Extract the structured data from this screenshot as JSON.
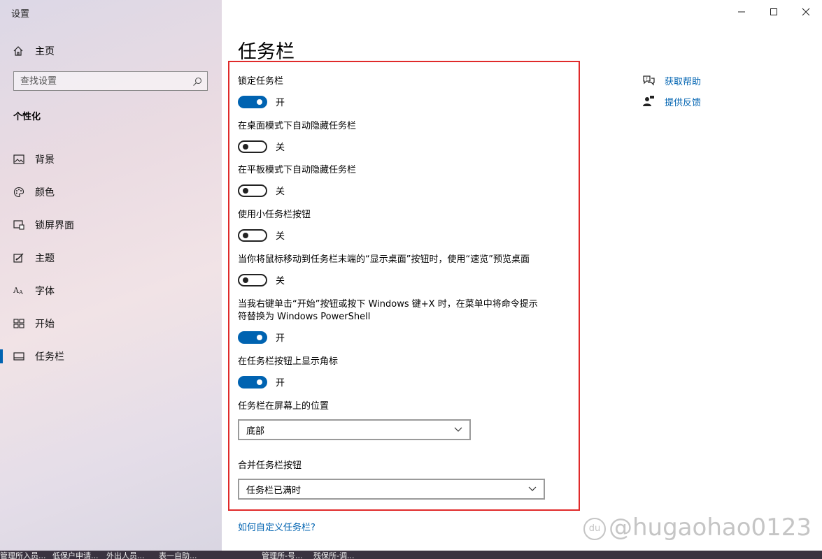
{
  "window": {
    "title": "设置"
  },
  "sidebar": {
    "home_label": "主页",
    "search_placeholder": "查找设置",
    "section": "个性化",
    "items": [
      {
        "label": "背景",
        "icon": "image-icon"
      },
      {
        "label": "颜色",
        "icon": "palette-icon"
      },
      {
        "label": "锁屏界面",
        "icon": "lock-screen-icon"
      },
      {
        "label": "主题",
        "icon": "theme-icon"
      },
      {
        "label": "字体",
        "icon": "font-icon"
      },
      {
        "label": "开始",
        "icon": "start-grid-icon"
      },
      {
        "label": "任务栏",
        "icon": "taskbar-icon",
        "active": true
      }
    ]
  },
  "main": {
    "title": "任务栏",
    "settings": [
      {
        "label": "锁定任务栏",
        "state": "开",
        "on": true
      },
      {
        "label": "在桌面模式下自动隐藏任务栏",
        "state": "关",
        "on": false
      },
      {
        "label": "在平板模式下自动隐藏任务栏",
        "state": "关",
        "on": false
      },
      {
        "label": "使用小任务栏按钮",
        "state": "关",
        "on": false
      },
      {
        "label": "当你将鼠标移动到任务栏末端的“显示桌面”按钮时，使用“速览”预览桌面",
        "state": "关",
        "on": false
      },
      {
        "label": "当我右键单击“开始”按钮或按下 Windows 键+X 时，在菜单中将命令提示符替换为 Windows PowerShell",
        "state": "开",
        "on": true
      },
      {
        "label": "在任务栏按钮上显示角标",
        "state": "开",
        "on": true
      }
    ],
    "position": {
      "label": "任务栏在屏幕上的位置",
      "value": "底部"
    },
    "combine": {
      "label": "合并任务栏按钮",
      "value": "任务栏已满时"
    },
    "customize_link": "如何自定义任务栏?"
  },
  "related": {
    "help": "获取帮助",
    "feedback": "提供反馈"
  },
  "accent_color": "#0063b1",
  "highlight_color": "#e02a2a",
  "taskbar_items": [
    "管理所入员...",
    "低保户申请...",
    "外出人员...",
    "表一自助...",
    "管理所-号...",
    "残保所-调..."
  ],
  "watermark": "@hugaohao0123"
}
